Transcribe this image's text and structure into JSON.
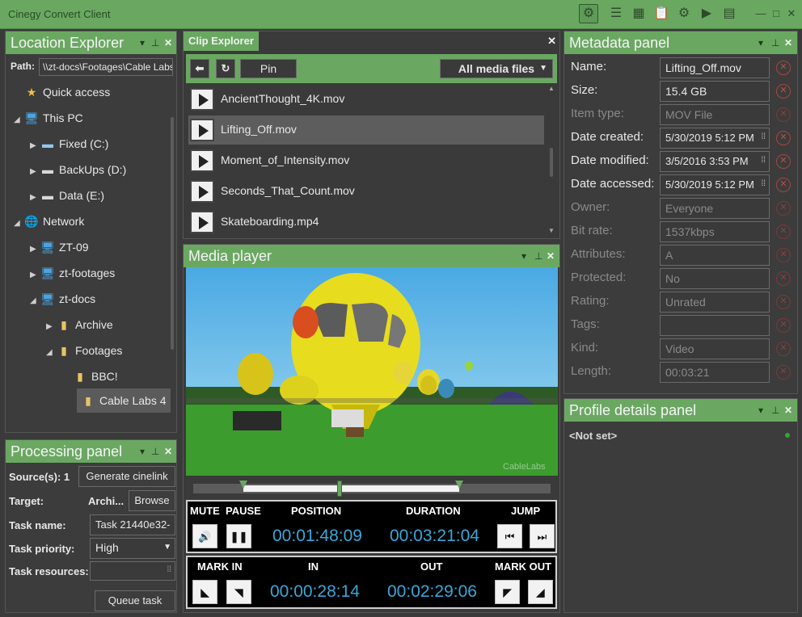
{
  "app": {
    "title": "Cinegy Convert Client"
  },
  "toolbar": {
    "icons": [
      "gear-icon",
      "list-icon",
      "grid-icon",
      "clipboard-icon",
      "cogs-icon",
      "play-icon",
      "report-icon"
    ]
  },
  "window": {
    "minimize": "—",
    "maximize": "□",
    "close": "✕"
  },
  "location": {
    "title": "Location Explorer",
    "path_label": "Path:",
    "path_value": "\\\\zt-docs\\Footages\\Cable Labs 4",
    "tree": [
      {
        "label": "Quick access"
      },
      {
        "label": "This PC"
      },
      {
        "label": "Fixed (C:)"
      },
      {
        "label": "BackUps (D:)"
      },
      {
        "label": "Data (E:)"
      },
      {
        "label": "Network"
      },
      {
        "label": "ZT-09"
      },
      {
        "label": "zt-footages"
      },
      {
        "label": "zt-docs"
      },
      {
        "label": "Archive"
      },
      {
        "label": "Footages"
      },
      {
        "label": "BBC!"
      },
      {
        "label": "Cable Labs 4"
      }
    ]
  },
  "processing": {
    "title": "Processing panel",
    "sources_label": "Source(s): 1",
    "generate_btn": "Generate cinelink",
    "target_label": "Target:",
    "target_value": "Archi...",
    "browse_btn": "Browse",
    "task_name_label": "Task name:",
    "task_name_value": "Task 21440e32-",
    "priority_label": "Task priority:",
    "priority_value": "High",
    "resources_label": "Task resources:",
    "queue_btn": "Queue task"
  },
  "clip": {
    "title": "Clip Explorer",
    "pin_btn": "Pin",
    "filter": "All media files",
    "items": [
      {
        "name": "AncientThought_4K.mov"
      },
      {
        "name": "Lifting_Off.mov"
      },
      {
        "name": "Moment_of_Intensity.mov"
      },
      {
        "name": "Seconds_That_Count.mov"
      },
      {
        "name": "Skateboarding.mp4"
      }
    ]
  },
  "player": {
    "title": "Media player",
    "watermark": "CableLabs",
    "timeline_position": 0.41,
    "mark_in_fraction": 0.14,
    "mark_out_fraction": 0.745,
    "mute_label": "MUTE",
    "pause_label": "PAUSE",
    "position_label": "POSITION",
    "duration_label": "DURATION",
    "jump_label": "JUMP",
    "position_value": "00:01:48:09",
    "duration_value": "00:03:21:04",
    "markin_label": "MARK IN",
    "in_label": "IN",
    "out_label": "OUT",
    "markout_label": "MARK OUT",
    "in_value": "00:00:28:14",
    "out_value": "00:02:29:06"
  },
  "metadata": {
    "title": "Metadata panel",
    "fields": [
      {
        "label": "Name:",
        "value": "Lifting_Off.mov"
      },
      {
        "label": "Size:",
        "value": "15.4 GB"
      },
      {
        "label": "Item type:",
        "value": "MOV File"
      },
      {
        "label": "Date created:",
        "value": "5/30/2019 5:12 PM"
      },
      {
        "label": "Date modified:",
        "value": "3/5/2016 3:53 PM"
      },
      {
        "label": "Date accessed:",
        "value": "5/30/2019 5:12 PM"
      },
      {
        "label": "Owner:",
        "value": "Everyone"
      },
      {
        "label": "Bit rate:",
        "value": "1537kbps"
      },
      {
        "label": "Attributes:",
        "value": "A"
      },
      {
        "label": "Protected:",
        "value": "No"
      },
      {
        "label": "Rating:",
        "value": "Unrated"
      },
      {
        "label": "Tags:",
        "value": ""
      },
      {
        "label": "Kind:",
        "value": "Video"
      },
      {
        "label": "Length:",
        "value": "00:03:21"
      }
    ]
  },
  "profile": {
    "title": "Profile details panel",
    "value": "<Not set>"
  },
  "colors": {
    "accent": "#6aa862",
    "timecode": "#3aa7d8"
  }
}
